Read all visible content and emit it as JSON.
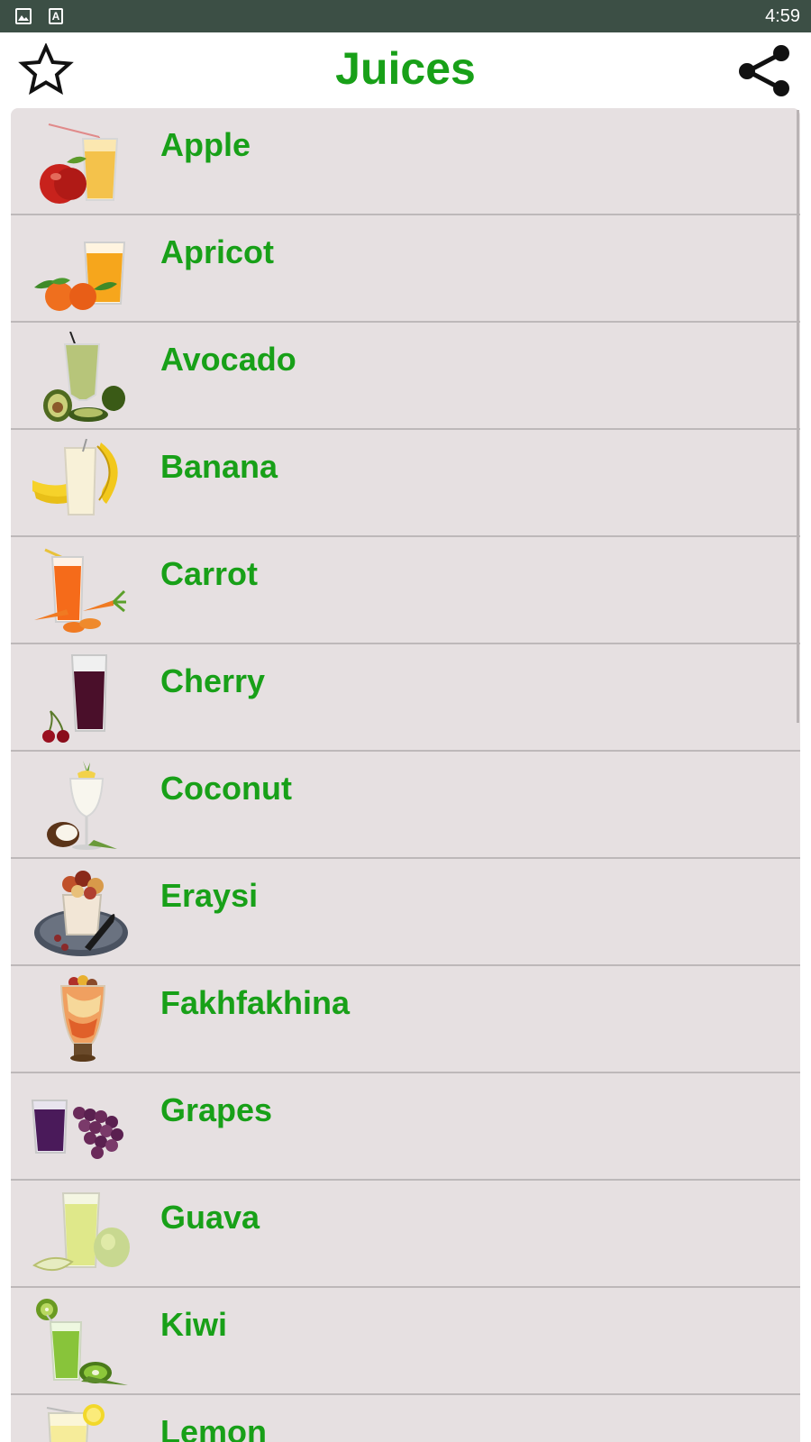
{
  "status_bar": {
    "time": "4:59",
    "text_icon_letter": "A"
  },
  "header": {
    "title": "Juices"
  },
  "list": {
    "items": [
      {
        "label": "Apple"
      },
      {
        "label": "Apricot"
      },
      {
        "label": "Avocado"
      },
      {
        "label": "Banana"
      },
      {
        "label": "Carrot"
      },
      {
        "label": "Cherry"
      },
      {
        "label": "Coconut"
      },
      {
        "label": "Eraysi"
      },
      {
        "label": "Fakhfakhina"
      },
      {
        "label": "Grapes"
      },
      {
        "label": "Guava"
      },
      {
        "label": "Kiwi"
      },
      {
        "label": "Lemon"
      }
    ]
  },
  "colors": {
    "accent": "#18a018",
    "status_bar": "#3c4f45",
    "list_background": "#e6e0e1",
    "divider": "#bdb8b9"
  },
  "icons": {
    "status_left": [
      "image-icon",
      "text-icon"
    ],
    "header_left": "star-outline-icon",
    "header_right": "share-icon"
  }
}
